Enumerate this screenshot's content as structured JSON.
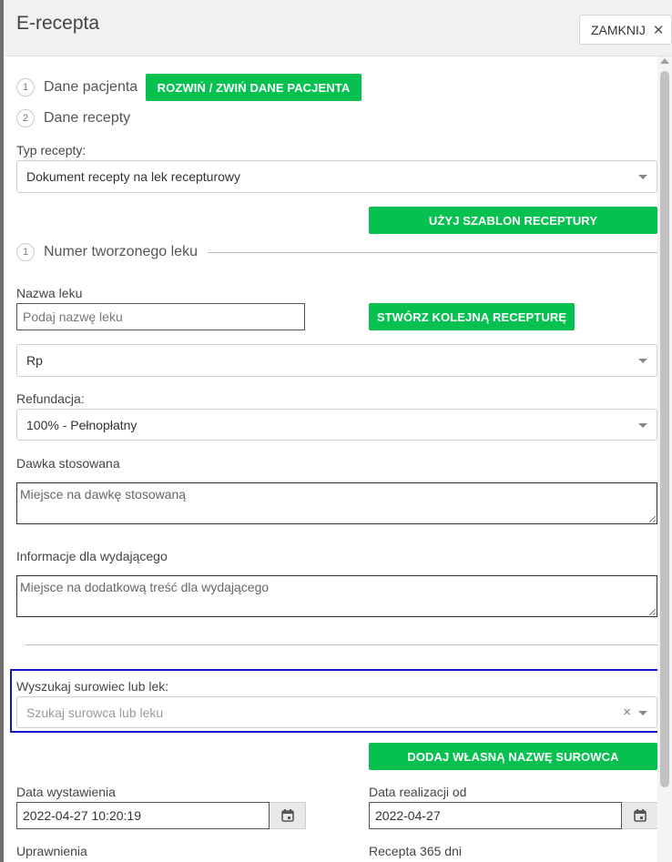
{
  "window": {
    "title": "E-recepta",
    "close_label": "ZAMKNIJ"
  },
  "steps": [
    {
      "number": "1",
      "label": "Dane pacjenta"
    },
    {
      "number": "2",
      "label": "Dane recepty"
    },
    {
      "number": "1",
      "label": "Numer tworzonego leku"
    }
  ],
  "buttons": {
    "toggle_patient": "ROZWIŃ / ZWIŃ DANE PACJENTA",
    "use_template": "UŻYJ SZABLON RECEPTURY",
    "create_next": "STWÓRZ KOLEJNĄ RECEPTURĘ",
    "add_own_name": "DODAJ WŁASNĄ NAZWĘ SUROWCA"
  },
  "form": {
    "recipe_type_label": "Typ recepty:",
    "recipe_type_value": "Dokument recepty na lek recepturowy",
    "drug_name_label": "Nazwa leku",
    "drug_name_placeholder": "Podaj nazwę leku",
    "rp_value": "Rp",
    "refund_label": "Refundacja:",
    "refund_value": "100% - Pełnopłatny",
    "dose_label": "Dawka stosowana",
    "dose_placeholder": "Miejsce na dawkę stosowaną",
    "info_label": "Informacje dla wydającego",
    "info_placeholder": "Miejsce na dodatkową treść dla wydającego",
    "search_label": "Wyszukaj surowiec lub lek:",
    "search_placeholder": "Szukaj surowca lub leku",
    "issue_date_label": "Data wystawienia",
    "issue_date_value": "2022-04-27 10:20:19",
    "realization_date_label": "Data realizacji od",
    "realization_date_value": "2022-04-27",
    "permissions_label": "Uprawnienia",
    "recipe365_label": "Recepta 365 dni"
  },
  "icons": {
    "close": "close-icon",
    "caret": "chevron-down-icon",
    "calendar": "calendar-icon",
    "clear": "clear-icon"
  },
  "colors": {
    "accent_green": "#06c050",
    "focus_blue": "#1414c8"
  }
}
